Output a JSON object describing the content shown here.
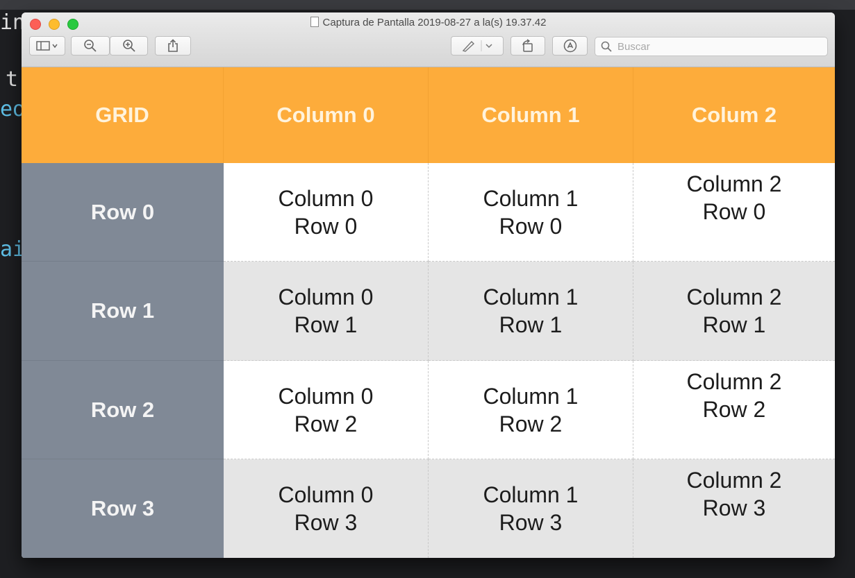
{
  "editor": {
    "code_fragments": [
      "in",
      "t",
      "eo",
      "ai"
    ]
  },
  "window": {
    "title": "Captura de Pantalla 2019-08-27 a la(s) 19.37.42",
    "toolbar": {
      "sidebar_icon": "sidebar-icon",
      "zoom_out_icon": "zoom-out-icon",
      "zoom_in_icon": "zoom-in-icon",
      "share_icon": "share-icon",
      "markup_icon": "pen-icon",
      "rotate_icon": "rotate-icon",
      "annotate_icon": "annotate-icon"
    },
    "search": {
      "placeholder": "Buscar",
      "value": ""
    }
  },
  "grid": {
    "corner_label": "GRID",
    "columns": [
      "Column 0",
      "Column 1",
      "Colum 2"
    ],
    "rows": [
      {
        "label": "Row 0",
        "cells": [
          {
            "line1": "Column 0",
            "line2": "Row 0"
          },
          {
            "line1": "Column 1",
            "line2": "Row 0"
          },
          {
            "line1": "Column 2",
            "line2": "Row 0"
          }
        ]
      },
      {
        "label": "Row 1",
        "cells": [
          {
            "line1": "Column 0",
            "line2": "Row 1"
          },
          {
            "line1": "Column 1",
            "line2": "Row 1"
          },
          {
            "line1": "Column 2",
            "line2": "Row 1"
          }
        ]
      },
      {
        "label": "Row 2",
        "cells": [
          {
            "line1": "Column 0",
            "line2": "Row 2"
          },
          {
            "line1": "Column 1",
            "line2": "Row 2"
          },
          {
            "line1": "Column 2",
            "line2": "Row 2"
          }
        ]
      },
      {
        "label": "Row 3",
        "cells": [
          {
            "line1": "Column 0",
            "line2": "Row 3"
          },
          {
            "line1": "Column 1",
            "line2": "Row 3"
          },
          {
            "line1": "Column 2",
            "line2": "Row 3"
          }
        ]
      }
    ]
  },
  "colors": {
    "header_orange": "#fdac3b",
    "row_header_slate": "#808996",
    "cell_alt_grey": "#e5e5e5"
  }
}
